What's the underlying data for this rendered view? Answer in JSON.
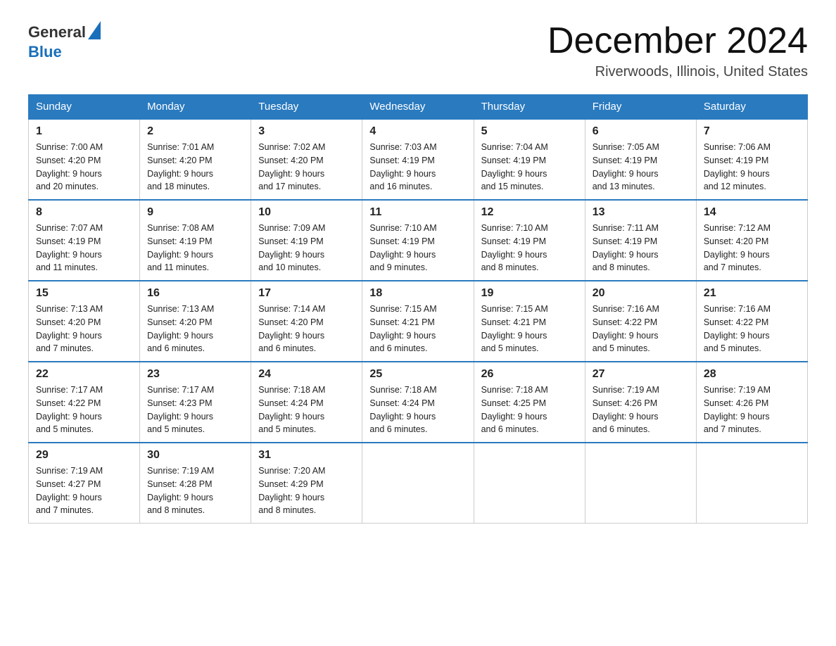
{
  "header": {
    "logo_general": "General",
    "logo_blue": "Blue",
    "month": "December 2024",
    "location": "Riverwoods, Illinois, United States"
  },
  "days_of_week": [
    "Sunday",
    "Monday",
    "Tuesday",
    "Wednesday",
    "Thursday",
    "Friday",
    "Saturday"
  ],
  "weeks": [
    [
      {
        "day": "1",
        "sunrise": "7:00 AM",
        "sunset": "4:20 PM",
        "daylight": "9 hours and 20 minutes."
      },
      {
        "day": "2",
        "sunrise": "7:01 AM",
        "sunset": "4:20 PM",
        "daylight": "9 hours and 18 minutes."
      },
      {
        "day": "3",
        "sunrise": "7:02 AM",
        "sunset": "4:20 PM",
        "daylight": "9 hours and 17 minutes."
      },
      {
        "day": "4",
        "sunrise": "7:03 AM",
        "sunset": "4:19 PM",
        "daylight": "9 hours and 16 minutes."
      },
      {
        "day": "5",
        "sunrise": "7:04 AM",
        "sunset": "4:19 PM",
        "daylight": "9 hours and 15 minutes."
      },
      {
        "day": "6",
        "sunrise": "7:05 AM",
        "sunset": "4:19 PM",
        "daylight": "9 hours and 13 minutes."
      },
      {
        "day": "7",
        "sunrise": "7:06 AM",
        "sunset": "4:19 PM",
        "daylight": "9 hours and 12 minutes."
      }
    ],
    [
      {
        "day": "8",
        "sunrise": "7:07 AM",
        "sunset": "4:19 PM",
        "daylight": "9 hours and 11 minutes."
      },
      {
        "day": "9",
        "sunrise": "7:08 AM",
        "sunset": "4:19 PM",
        "daylight": "9 hours and 11 minutes."
      },
      {
        "day": "10",
        "sunrise": "7:09 AM",
        "sunset": "4:19 PM",
        "daylight": "9 hours and 10 minutes."
      },
      {
        "day": "11",
        "sunrise": "7:10 AM",
        "sunset": "4:19 PM",
        "daylight": "9 hours and 9 minutes."
      },
      {
        "day": "12",
        "sunrise": "7:10 AM",
        "sunset": "4:19 PM",
        "daylight": "9 hours and 8 minutes."
      },
      {
        "day": "13",
        "sunrise": "7:11 AM",
        "sunset": "4:19 PM",
        "daylight": "9 hours and 8 minutes."
      },
      {
        "day": "14",
        "sunrise": "7:12 AM",
        "sunset": "4:20 PM",
        "daylight": "9 hours and 7 minutes."
      }
    ],
    [
      {
        "day": "15",
        "sunrise": "7:13 AM",
        "sunset": "4:20 PM",
        "daylight": "9 hours and 7 minutes."
      },
      {
        "day": "16",
        "sunrise": "7:13 AM",
        "sunset": "4:20 PM",
        "daylight": "9 hours and 6 minutes."
      },
      {
        "day": "17",
        "sunrise": "7:14 AM",
        "sunset": "4:20 PM",
        "daylight": "9 hours and 6 minutes."
      },
      {
        "day": "18",
        "sunrise": "7:15 AM",
        "sunset": "4:21 PM",
        "daylight": "9 hours and 6 minutes."
      },
      {
        "day": "19",
        "sunrise": "7:15 AM",
        "sunset": "4:21 PM",
        "daylight": "9 hours and 5 minutes."
      },
      {
        "day": "20",
        "sunrise": "7:16 AM",
        "sunset": "4:22 PM",
        "daylight": "9 hours and 5 minutes."
      },
      {
        "day": "21",
        "sunrise": "7:16 AM",
        "sunset": "4:22 PM",
        "daylight": "9 hours and 5 minutes."
      }
    ],
    [
      {
        "day": "22",
        "sunrise": "7:17 AM",
        "sunset": "4:22 PM",
        "daylight": "9 hours and 5 minutes."
      },
      {
        "day": "23",
        "sunrise": "7:17 AM",
        "sunset": "4:23 PM",
        "daylight": "9 hours and 5 minutes."
      },
      {
        "day": "24",
        "sunrise": "7:18 AM",
        "sunset": "4:24 PM",
        "daylight": "9 hours and 5 minutes."
      },
      {
        "day": "25",
        "sunrise": "7:18 AM",
        "sunset": "4:24 PM",
        "daylight": "9 hours and 6 minutes."
      },
      {
        "day": "26",
        "sunrise": "7:18 AM",
        "sunset": "4:25 PM",
        "daylight": "9 hours and 6 minutes."
      },
      {
        "day": "27",
        "sunrise": "7:19 AM",
        "sunset": "4:26 PM",
        "daylight": "9 hours and 6 minutes."
      },
      {
        "day": "28",
        "sunrise": "7:19 AM",
        "sunset": "4:26 PM",
        "daylight": "9 hours and 7 minutes."
      }
    ],
    [
      {
        "day": "29",
        "sunrise": "7:19 AM",
        "sunset": "4:27 PM",
        "daylight": "9 hours and 7 minutes."
      },
      {
        "day": "30",
        "sunrise": "7:19 AM",
        "sunset": "4:28 PM",
        "daylight": "9 hours and 8 minutes."
      },
      {
        "day": "31",
        "sunrise": "7:20 AM",
        "sunset": "4:29 PM",
        "daylight": "9 hours and 8 minutes."
      },
      null,
      null,
      null,
      null
    ]
  ],
  "labels": {
    "sunrise": "Sunrise:",
    "sunset": "Sunset:",
    "daylight": "Daylight:"
  }
}
